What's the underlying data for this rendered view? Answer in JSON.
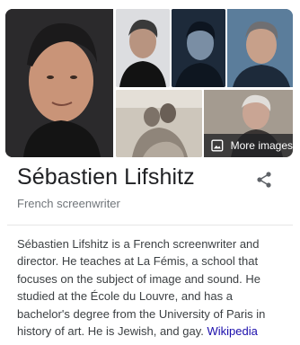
{
  "panel": {
    "name": "Sébastien Lifshitz",
    "occupation": "French screenwriter",
    "more_images_label": "More images",
    "description": "Sébastien Lifshitz is a French screenwriter and director. He teaches at La Fémis, a school that focuses on the subject of image and sound. He studied at the École du Louvre, and has a bachelor's degree from the University of Paris in history of art. He is Jewish, and gay.",
    "source_link": "Wikipedia",
    "share_icon": "share-icon",
    "image_icon": "image-icon"
  },
  "colors": {
    "title": "#202124",
    "secondary": "#70757a",
    "link": "#1a0dab"
  }
}
